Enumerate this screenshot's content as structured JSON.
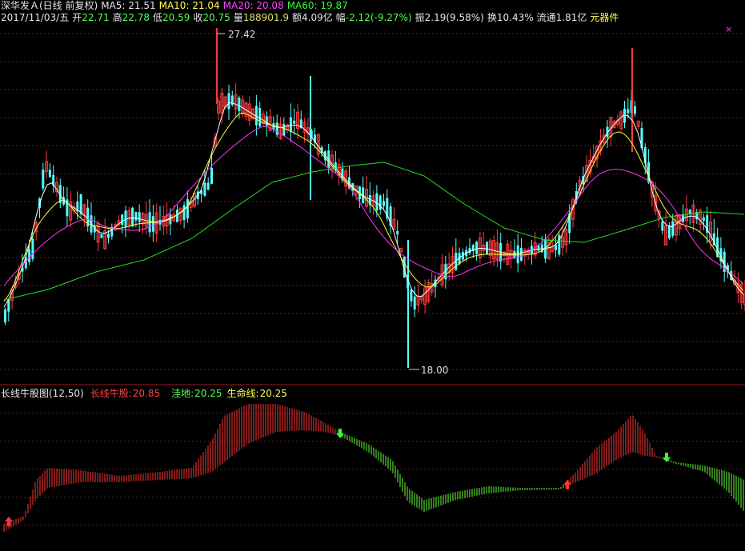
{
  "header": {
    "stock_title": "深华发Ａ(日线 前复权)",
    "ma5": "MA5: 21.51",
    "ma10": "MA10: 21.04",
    "ma20": "MA20: 20.08",
    "ma60": "MA60: 19.87"
  },
  "quote": {
    "date": "2017/11/03/五",
    "open_label": "开",
    "open": "22.71",
    "high_label": "高",
    "high": "22.78",
    "low_label": "低",
    "low": "20.59",
    "close_label": "收",
    "close": "20.75",
    "vol_label": "量",
    "vol": "188901.9",
    "amount_label": "额",
    "amount": "4.09亿",
    "chg_label": "幅",
    "chg": "-2.12(-9.27%)",
    "amp_label": "振",
    "amp": "2.19(9.58%)",
    "turnover_label": "换",
    "turnover": "10.43%",
    "float_label": "流通",
    "float": "1.81亿",
    "sector": "元器件"
  },
  "price_chart": {
    "high_marker": "27.42",
    "low_marker": "18.00",
    "close_mark": "×"
  },
  "indicator": {
    "name": "长线牛股图(12,50)",
    "bull_label": "长线牛股:",
    "bull_value": "20.85",
    "ground_label": "洼地:",
    "ground_value": "20.25",
    "life_label": "生命线:",
    "life_value": "20.25"
  },
  "colors": {
    "up": "#ff3b3b",
    "down": "#54ffff",
    "ma5": "#ffffff",
    "ma10": "#ffff33",
    "ma20": "#ff33ff",
    "ma60": "#22dd22",
    "indicator_red": "#ff3333",
    "indicator_green": "#66ff33",
    "grid": "#7a1515"
  }
}
